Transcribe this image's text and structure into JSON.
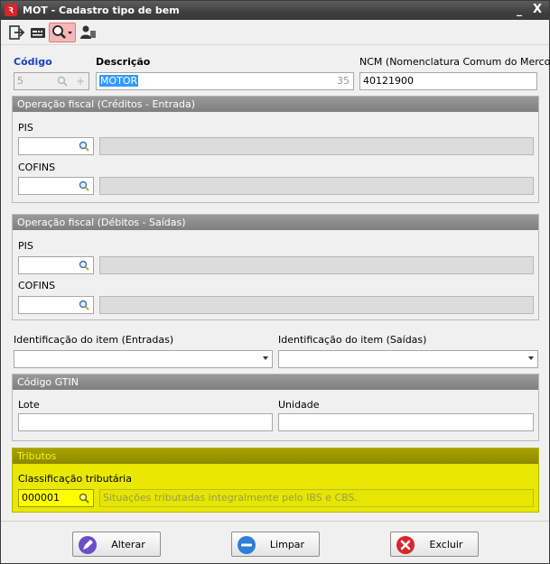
{
  "window": {
    "title": "MOT - Cadastro tipo de bem",
    "minimize": "_",
    "close": "X"
  },
  "form": {
    "codigo_label": "Código",
    "codigo_value": "5",
    "descricao_label": "Descrição",
    "descricao_value": "MOTOR",
    "descricao_maxlen": "35",
    "ncm_label": "NCM (Nomenclatura Comum do Mercosul)",
    "ncm_value": "40121900"
  },
  "op_entrada": {
    "title": "Operação fiscal (Créditos - Entrada)",
    "pis_label": "PIS",
    "cofins_label": "COFINS"
  },
  "op_saida": {
    "title": "Operação fiscal (Débitos - Saídas)",
    "pis_label": "PIS",
    "cofins_label": "COFINS"
  },
  "ident": {
    "entradas_label": "Identificação do item (Entradas)",
    "saidas_label": "Identificação do item (Saídas)"
  },
  "gtin": {
    "title": "Código GTIN",
    "lote_label": "Lote",
    "unidade_label": "Unidade"
  },
  "tributos": {
    "title": "Tributos",
    "classificacao_label": "Classificação tributária",
    "code_value": "000001",
    "description_value": "Situações tributadas integralmente pelo IBS e CBS."
  },
  "buttons": {
    "alterar": "Alterar",
    "limpar": "Limpar",
    "excluir": "Excluir"
  },
  "colors": {
    "highlight": "#e8e800",
    "accent_blue": "#1a3fbf",
    "title_bar": "#3f3f3f"
  }
}
